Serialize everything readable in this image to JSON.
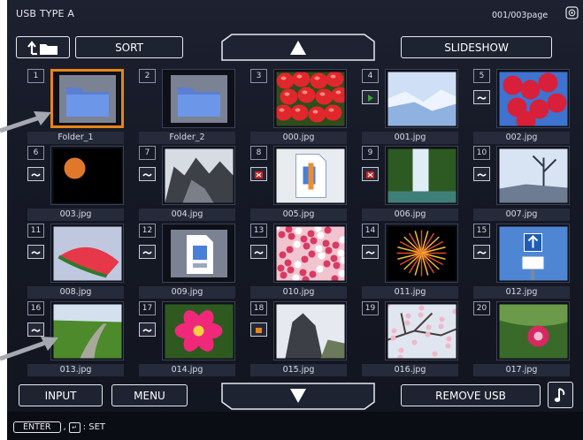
{
  "header": {
    "title": "USB TYPE A",
    "page": "001/003page"
  },
  "toolbar": {
    "sort": "SORT",
    "slideshow": "SLIDESHOW"
  },
  "bottom_bar": {
    "input": "INPUT",
    "menu": "MENU",
    "remove_usb": "REMOVE USB"
  },
  "hint": {
    "enter": "ENTER",
    "set": ": SET"
  },
  "items": [
    {
      "num": "1",
      "name": "Folder_1",
      "kind": "folder",
      "selected": true
    },
    {
      "num": "2",
      "name": "Folder_2",
      "kind": "folder"
    },
    {
      "num": "3",
      "name": "000.jpg",
      "kind": "strawberries"
    },
    {
      "num": "4",
      "name": "001.jpg",
      "kind": "snow",
      "status": "play"
    },
    {
      "num": "5",
      "name": "002.jpg",
      "kind": "redleaves",
      "status": "tilde"
    },
    {
      "num": "6",
      "name": "003.jpg",
      "kind": "moon",
      "status": "tilde"
    },
    {
      "num": "7",
      "name": "004.jpg",
      "kind": "rock",
      "status": "tilde"
    },
    {
      "num": "8",
      "name": "005.jpg",
      "kind": "doc",
      "status": "x"
    },
    {
      "num": "9",
      "name": "006.jpg",
      "kind": "waterfall",
      "status": "x"
    },
    {
      "num": "10",
      "name": "007.jpg",
      "kind": "tree",
      "status": "tilde"
    },
    {
      "num": "11",
      "name": "008.jpg",
      "kind": "watermelon",
      "status": "tilde"
    },
    {
      "num": "12",
      "name": "009.jpg",
      "kind": "file",
      "status": "tilde"
    },
    {
      "num": "13",
      "name": "010.jpg",
      "kind": "blossom",
      "status": "tilde"
    },
    {
      "num": "14",
      "name": "011.jpg",
      "kind": "fireworks",
      "status": "tilde"
    },
    {
      "num": "15",
      "name": "012.jpg",
      "kind": "sign",
      "status": "tilde"
    },
    {
      "num": "16",
      "name": "013.jpg",
      "kind": "road",
      "status": "tilde"
    },
    {
      "num": "17",
      "name": "014.jpg",
      "kind": "flower",
      "status": "tilde"
    },
    {
      "num": "18",
      "name": "015.jpg",
      "kind": "cliff",
      "status": "stop"
    },
    {
      "num": "19",
      "name": "016.jpg",
      "kind": "branches"
    },
    {
      "num": "20",
      "name": "017.jpg",
      "kind": "bloom"
    }
  ],
  "icons": {
    "parent_folder": "folder-up-icon",
    "page_indicator": "page-indicator-icon",
    "scroll_up": "triangle-up-icon",
    "scroll_down": "triangle-down-icon",
    "music": "music-note-icon",
    "set": "enter-key-icon"
  },
  "colors": {
    "selection": "#e88418",
    "status_x": "#d02020",
    "status_play": "#3ca43c",
    "status_stop": "#e88418"
  }
}
